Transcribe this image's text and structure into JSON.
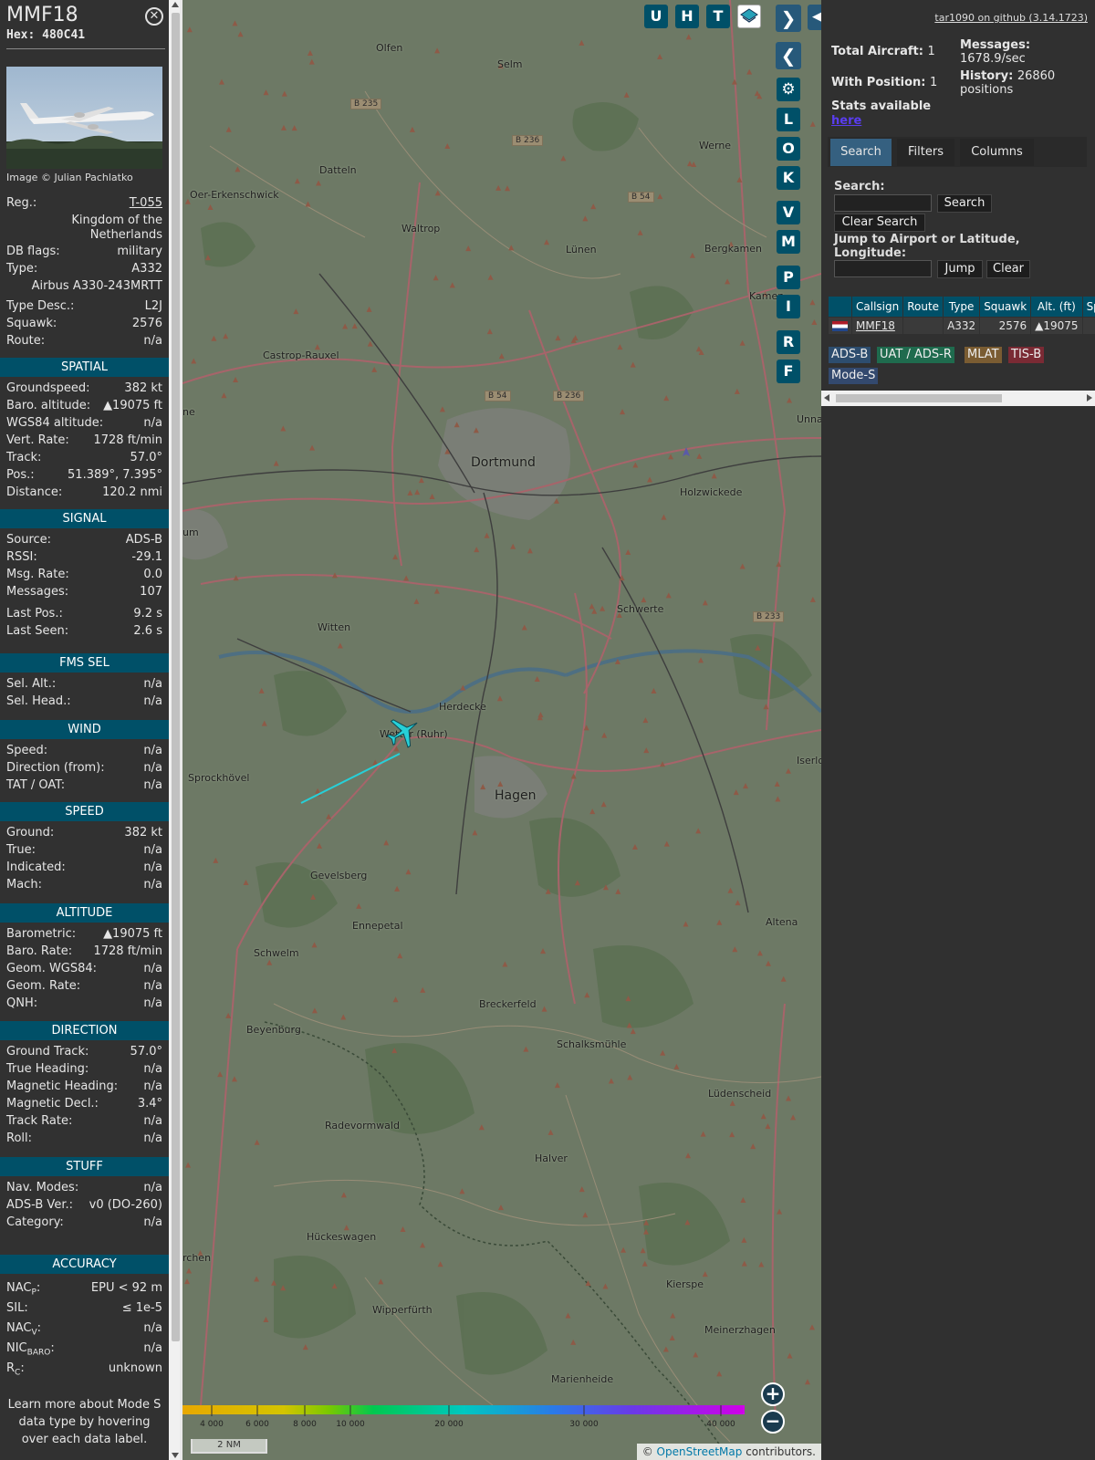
{
  "aircraft": {
    "callsign": "MMF18",
    "hex": "Hex: 480C41",
    "image_credit": "Image © Julian Pachlatko",
    "reg_label": "Reg.:",
    "reg": "T-055",
    "country": "Kingdom of the Netherlands",
    "dbflags_label": "DB flags:",
    "dbflags": "military",
    "type_label": "Type:",
    "type": "A332",
    "type_full": "Airbus A330-243MRTT",
    "typedesc_label": "Type Desc.:",
    "typedesc": "L2J",
    "squawk_label": "Squawk:",
    "squawk": "2576",
    "route_label": "Route:",
    "route": "n/a"
  },
  "sections": {
    "spatial": "SPATIAL",
    "signal": "SIGNAL",
    "fms": "FMS SEL",
    "wind": "WIND",
    "speed": "SPEED",
    "altitude": "ALTITUDE",
    "direction": "DIRECTION",
    "stuff": "STUFF",
    "accuracy": "ACCURACY"
  },
  "spatial": [
    {
      "label": "Groundspeed:",
      "value": "382 kt"
    },
    {
      "label": "Baro. altitude:",
      "value": "▲19075 ft"
    },
    {
      "label": "WGS84 altitude:",
      "value": "n/a"
    },
    {
      "label": "Vert. Rate:",
      "value": "1728 ft/min"
    },
    {
      "label": "Track:",
      "value": "57.0°"
    },
    {
      "label": "Pos.:",
      "value": "51.389°, 7.395°"
    },
    {
      "label": "Distance:",
      "value": "120.2 nmi"
    }
  ],
  "signal": [
    {
      "label": "Source:",
      "value": "ADS-B"
    },
    {
      "label": "RSSI:",
      "value": "-29.1"
    },
    {
      "label": "Msg. Rate:",
      "value": "0.0"
    },
    {
      "label": "Messages:",
      "value": "107"
    },
    {
      "label": "Last Pos.:",
      "value": "9.2 s"
    },
    {
      "label": "Last Seen:",
      "value": "2.6 s"
    }
  ],
  "fms": [
    {
      "label": "Sel. Alt.:",
      "value": "n/a"
    },
    {
      "label": "Sel. Head.:",
      "value": "n/a"
    }
  ],
  "wind": [
    {
      "label": "Speed:",
      "value": "n/a"
    },
    {
      "label": "Direction (from):",
      "value": "n/a"
    },
    {
      "label": "TAT / OAT:",
      "value": "n/a"
    }
  ],
  "speed": [
    {
      "label": "Ground:",
      "value": "382 kt"
    },
    {
      "label": "True:",
      "value": "n/a"
    },
    {
      "label": "Indicated:",
      "value": "n/a"
    },
    {
      "label": "Mach:",
      "value": "n/a"
    }
  ],
  "altitude": [
    {
      "label": "Barometric:",
      "value": "▲19075 ft"
    },
    {
      "label": "Baro. Rate:",
      "value": "1728 ft/min"
    },
    {
      "label": "Geom. WGS84:",
      "value": "n/a"
    },
    {
      "label": "Geom. Rate:",
      "value": "n/a"
    },
    {
      "label": "QNH:",
      "value": "n/a"
    }
  ],
  "direction": [
    {
      "label": "Ground Track:",
      "value": "57.0°"
    },
    {
      "label": "True Heading:",
      "value": "n/a"
    },
    {
      "label": "Magnetic Heading:",
      "value": "n/a"
    },
    {
      "label": "Magnetic Decl.:",
      "value": "3.4°"
    },
    {
      "label": "Track Rate:",
      "value": "n/a"
    },
    {
      "label": "Roll:",
      "value": "n/a"
    }
  ],
  "stuff": [
    {
      "label": "Nav. Modes:",
      "value": "n/a"
    },
    {
      "label": "ADS-B Ver.:",
      "value": "v0 (DO-260)"
    },
    {
      "label": "Category:",
      "value": "n/a"
    }
  ],
  "accuracy": {
    "nacp_a": "NAC",
    "nacp_b": "P",
    "nacp_c": ":",
    "nacp_value": "EPU < 92 m",
    "sil_label": "SIL:",
    "sil_value": "≤ 1e-5",
    "nacv_a": "NAC",
    "nacv_b": "V",
    "nacv_c": ":",
    "nacv_value": "n/a",
    "nic_a": "NIC",
    "nic_b": "BARO",
    "nic_c": ":",
    "nic_value": "n/a",
    "rc_a": "R",
    "rc_b": "C",
    "rc_c": ":",
    "rc_value": "unknown"
  },
  "footer": "Learn more about Mode S data type by hovering over each data label.",
  "map": {
    "buttons_top": [
      "U",
      "H",
      "T"
    ],
    "buttons_side": [
      "L",
      "O",
      "K",
      "V",
      "M",
      "P",
      "I",
      "R",
      "F"
    ],
    "towns": [
      {
        "name": "Olfen"
      },
      {
        "name": "Selm"
      },
      {
        "name": "Werne"
      },
      {
        "name": "Datteln"
      },
      {
        "name": "Oer-Erkenschwick"
      },
      {
        "name": "Waltrop"
      },
      {
        "name": "Lünen"
      },
      {
        "name": "Bergkamen"
      },
      {
        "name": "Kamen"
      },
      {
        "name": "Castrop-Rauxel"
      },
      {
        "name": "Dortmund"
      },
      {
        "name": "Holzwickede"
      },
      {
        "name": "Unna"
      },
      {
        "name": "Schwerte"
      },
      {
        "name": "Witten"
      },
      {
        "name": "Herdecke"
      },
      {
        "name": "Wetter (Ruhr)"
      },
      {
        "name": "Sprockhövel"
      },
      {
        "name": "Hagen"
      },
      {
        "name": "Gevelsberg"
      },
      {
        "name": "Ennepetal"
      },
      {
        "name": "Schwelm"
      },
      {
        "name": "Breckerfeld"
      },
      {
        "name": "Beyenburg"
      },
      {
        "name": "Schalksmühle"
      },
      {
        "name": "Lüdenscheid"
      },
      {
        "name": "Radevormwald"
      },
      {
        "name": "Halver"
      },
      {
        "name": "Hückeswagen"
      },
      {
        "name": "Kierspe"
      },
      {
        "name": "Wipperfürth"
      },
      {
        "name": "Meinerzhagen"
      },
      {
        "name": "Marienheide"
      },
      {
        "name": "Altena"
      },
      {
        "name": "Iserlo"
      },
      {
        "name": "um"
      },
      {
        "name": "ne"
      },
      {
        "name": "rchen"
      }
    ],
    "roads": [
      "B 235",
      "B 236",
      "B 54",
      "B 54",
      "B 236",
      "B 233"
    ],
    "altitude_ticks": [
      "4 000",
      "6 000",
      "8 000",
      "10 000",
      "20 000",
      "30 000",
      "40 000"
    ],
    "scale": "2 NM",
    "attribution_a": "© ",
    "attribution_b": "OpenStreetMap",
    "attribution_c": " contributors."
  },
  "panel": {
    "github": "tar1090 on github (3.14.1723)",
    "total_aircraft_label": "Total Aircraft:",
    "total_aircraft": "1",
    "with_position_label": "With Position:",
    "with_position": "1",
    "messages_label": "Messages:",
    "messages": "1678.9/sec",
    "history_label": "History:",
    "history_a": "26860",
    "history_b": "positions",
    "stats_label": "Stats available",
    "stats_link": "here",
    "tabs": [
      "Search",
      "Filters",
      "Columns"
    ],
    "search_label": "Search:",
    "search_button": "Search",
    "clear_search_button": "Clear Search",
    "jump_label": "Jump to Airport or Latitude, Longitude:",
    "jump_button": "Jump",
    "clear_button": "Clear",
    "columns": [
      "Callsign",
      "Route",
      "Type",
      "Squawk",
      "Alt. (ft)",
      "Spd"
    ],
    "rows": [
      {
        "callsign": "MMF18",
        "route": "",
        "type": "A332",
        "squawk": "2576",
        "alt": "▲19075",
        "spd": ""
      }
    ],
    "legend": [
      "ADS-B",
      "UAT / ADS-R",
      "MLAT",
      "TIS-B",
      "Mode-S"
    ]
  },
  "colors": {
    "section": "#005068",
    "adsb": "#2d4d6e",
    "uat": "#1f6b4e",
    "mlat": "#7a5c32",
    "tisb": "#7a2a34",
    "modes": "#33496e",
    "track": "#27d0d8"
  }
}
